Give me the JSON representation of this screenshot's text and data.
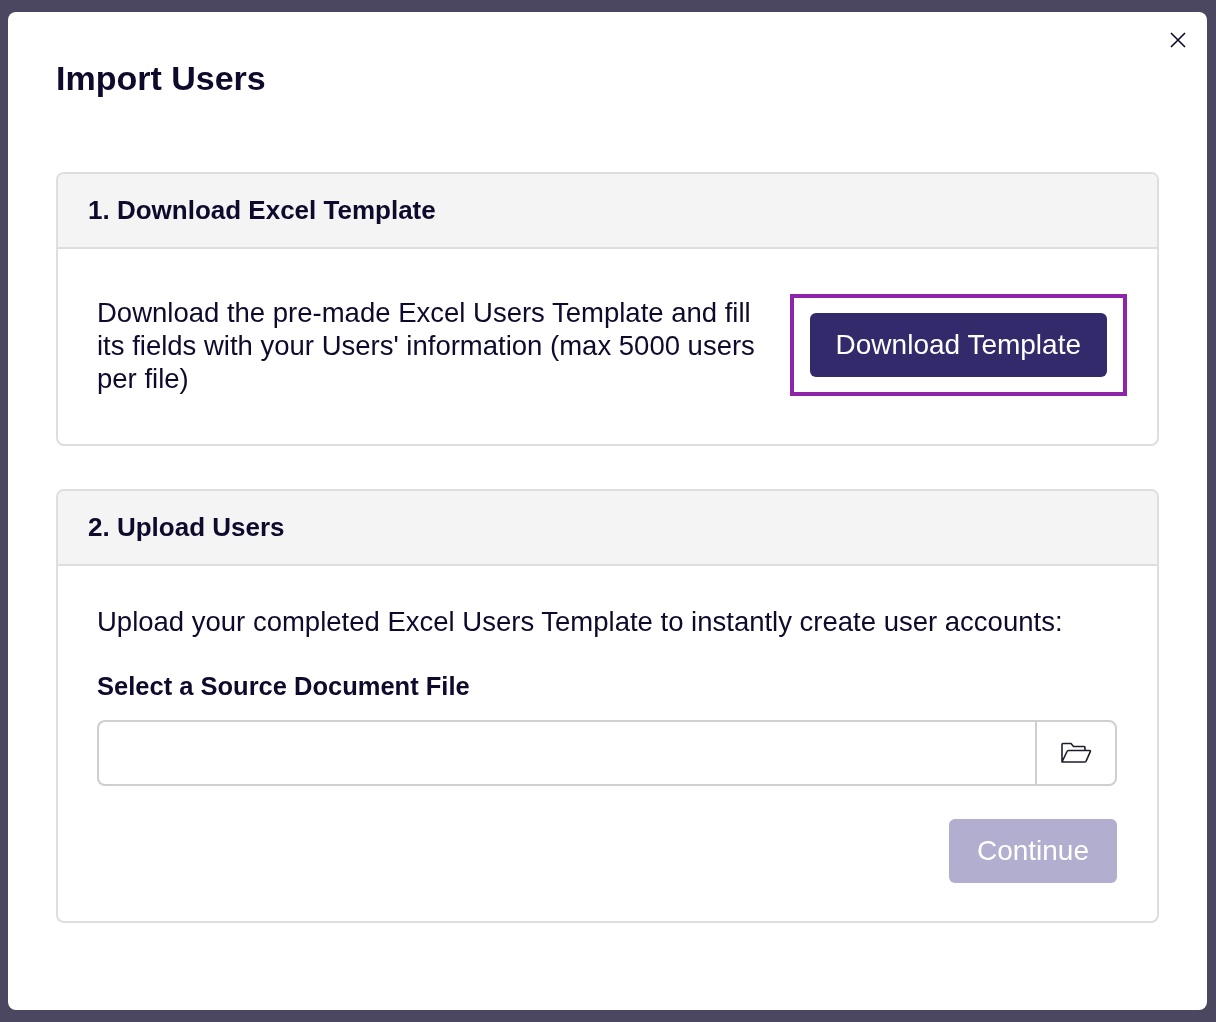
{
  "dialog": {
    "title": "Import Users"
  },
  "sections": [
    {
      "kind": "download",
      "heading": "1. Download Excel Template",
      "text": "Download the pre-made Excel Users Template and fill its fields with your Users' information (max 5000 users per file)",
      "button": {
        "label": "Download Template",
        "highlighted": true
      }
    },
    {
      "kind": "upload",
      "heading": "2. Upload Users",
      "text": "Upload your completed Excel Users Template to instantly create user accounts:",
      "field": {
        "label": "Select a Source Document File"
      },
      "button": {
        "label": "Continue",
        "disabled": true
      }
    }
  ]
}
